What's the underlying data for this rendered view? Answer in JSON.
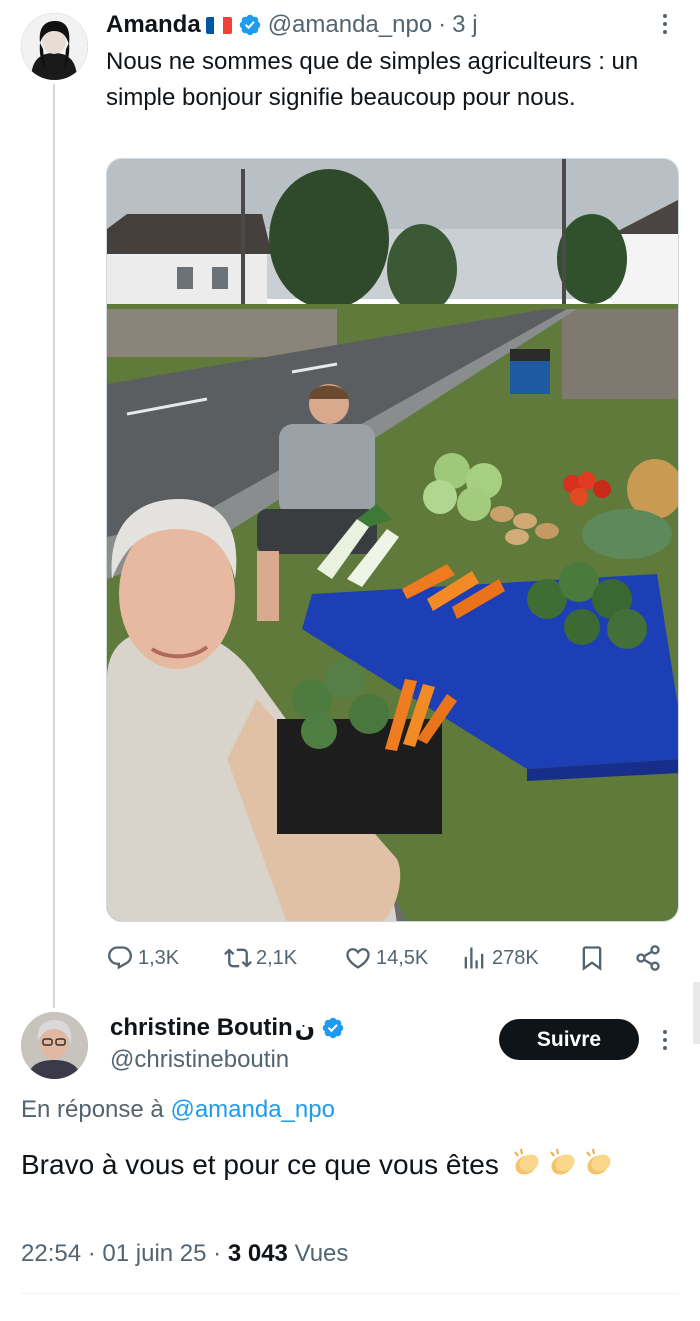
{
  "post": {
    "author_name": "Amanda",
    "author_flag": "france-flag-icon",
    "author_handle": "@amanda_npo",
    "separator": "·",
    "time_ago": "3 j",
    "text": "Nous ne sommes que de simples agriculteurs : un simple bonjour signifie beaucoup pour nous.",
    "stats": {
      "replies": "1,3K",
      "reposts": "2,1K",
      "likes": "14,5K",
      "views": "278K"
    }
  },
  "reply": {
    "author_name": "christine Boutin",
    "name_suffix": "ن",
    "author_handle": "@christineboutin",
    "follow_label": "Suivre",
    "reply_prefix": "En réponse à",
    "reply_mention": "@amanda_npo",
    "text": "Bravo à vous et pour ce que vous êtes",
    "time": "22:54",
    "date": "01 juin 25",
    "separator": "·",
    "views_count": "3 043",
    "views_label": "Vues"
  },
  "colors": {
    "accent": "#1d9bf0",
    "text_primary": "#0f1419",
    "text_secondary": "#536471",
    "button_bg": "#0f1419"
  }
}
